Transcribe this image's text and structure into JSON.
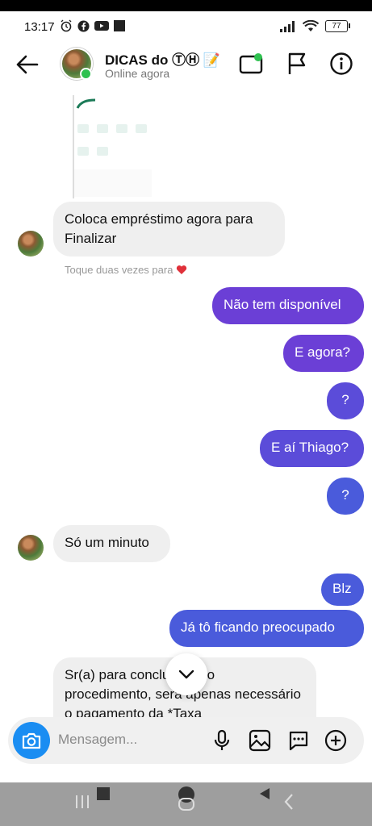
{
  "status": {
    "time": "13:17",
    "battery": "77"
  },
  "header": {
    "title": "DICAS do ⓉⒽ 📝",
    "subtitle": "Online agora"
  },
  "messages": {
    "in1": "Coloca empréstimo agora para  Finalizar",
    "hint": "Toque duas vezes para",
    "out1": "Não tem disponível",
    "out2": "E agora?",
    "out3": "?",
    "out4": "E aí Thiago?",
    "out5": "?",
    "in2": "Só um minuto",
    "out6": "Blz",
    "out7": "Já tô ficando preocupado",
    "in3": "Sr(a) para concluirmos o procedimento, será apenas necessário o pagamento da *Taxa"
  },
  "composer": {
    "placeholder": "Mensagem..."
  },
  "colors": {
    "accent": "#6b3fd6",
    "blue": "#4a5bdb",
    "camera": "#1a8df2",
    "online": "#2fc150"
  },
  "icons": [
    "back-arrow-icon",
    "video-call-icon",
    "flag-icon",
    "info-icon",
    "camera-icon",
    "microphone-icon",
    "gallery-icon",
    "sticker-icon",
    "plus-icon",
    "chevron-down-icon",
    "heart-icon"
  ]
}
